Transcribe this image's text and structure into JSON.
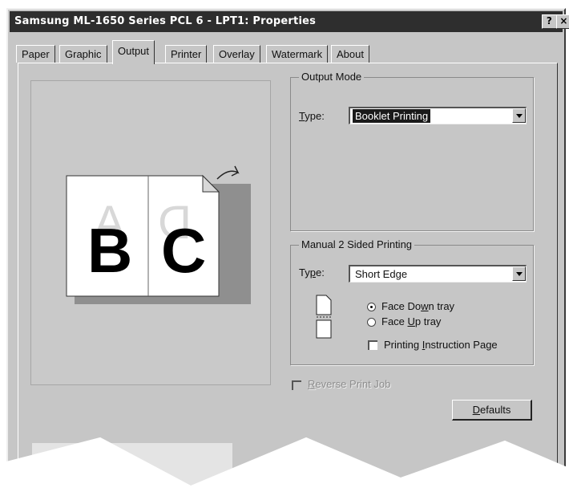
{
  "window": {
    "title": "Samsung ML-1650 Series PCL 6 - LPT1: Properties",
    "help_label": "?",
    "close_label": "×"
  },
  "tabs": [
    {
      "label": "Paper"
    },
    {
      "label": "Graphic"
    },
    {
      "label": "Output",
      "active": true
    },
    {
      "label": "Printer"
    },
    {
      "label": "Overlay"
    },
    {
      "label": "Watermark"
    },
    {
      "label": "About"
    }
  ],
  "preview": {
    "ghost_letters": [
      "A",
      "D"
    ],
    "letters": [
      "B",
      "C"
    ]
  },
  "output_mode": {
    "legend": "Output Mode",
    "type_label_mnemonic": "T",
    "type_label_rest": "ype:",
    "type_value": "Booklet Printing"
  },
  "manual_duplex": {
    "legend": "Manual 2 Sided Printing",
    "type_label_pre": "Ty",
    "type_label_mnemonic": "p",
    "type_label_post": "e:",
    "type_value": "Short Edge",
    "face_down_pre": "Face Do",
    "face_down_mnemonic": "w",
    "face_down_post": "n tray",
    "face_down_selected": true,
    "face_up_pre": "Face ",
    "face_up_mnemonic": "U",
    "face_up_post": "p tray",
    "face_up_selected": false,
    "instruction_pre": "Printing ",
    "instruction_mnemonic": "I",
    "instruction_post": "nstruction Page",
    "instruction_checked": false
  },
  "reverse_print": {
    "label_mnemonic": "R",
    "label_rest": "everse Print Job",
    "enabled": false
  },
  "defaults_button": {
    "label_mnemonic": "D",
    "label_rest": "efaults"
  }
}
